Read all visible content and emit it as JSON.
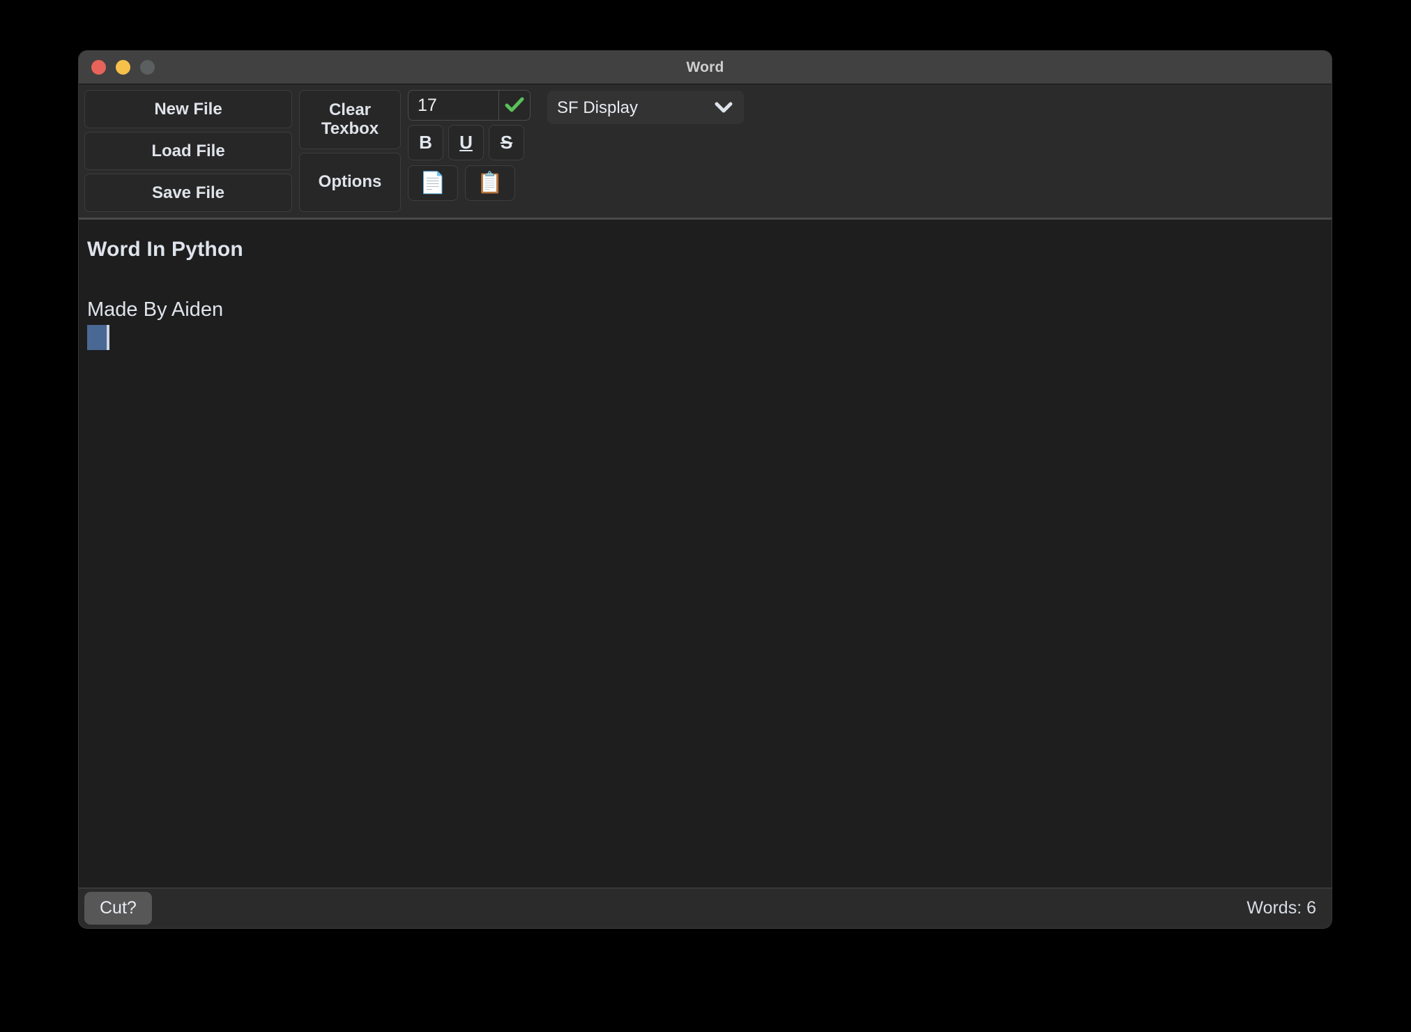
{
  "window": {
    "title": "Word",
    "traffic_lights": [
      {
        "name": "close",
        "color": "#e8635a"
      },
      {
        "name": "minimize",
        "color": "#f5c14b"
      },
      {
        "name": "zoom",
        "color": "#5c5f5f"
      }
    ]
  },
  "toolbar": {
    "file_buttons": [
      {
        "label": "New File"
      },
      {
        "label": "Load File"
      },
      {
        "label": "Save File"
      }
    ],
    "clear_textbox_label": "Clear\nTexbox",
    "clear_textbox_line1": "Clear",
    "clear_textbox_line2": "Texbox",
    "options_label": "Options",
    "font_size": {
      "value": "17",
      "placeholder": "Size",
      "confirm_icon": "checkmark-icon",
      "confirm_color": "#5bbf5b"
    },
    "style_buttons": [
      {
        "name": "bold",
        "label": "B"
      },
      {
        "name": "underline",
        "label": "U"
      },
      {
        "name": "strikethrough",
        "label": "S"
      }
    ],
    "clipboard_buttons": [
      {
        "name": "copy",
        "icon": "copy-pages-icon",
        "glyph": "📄"
      },
      {
        "name": "paste",
        "icon": "clipboard-icon",
        "glyph": "📋"
      }
    ],
    "font_family": {
      "selected": "SF Display",
      "options": [
        "SF Display"
      ],
      "chevron_icon": "chevron-down-icon"
    }
  },
  "document": {
    "heading": "Word In Python",
    "paragraph": "Made By Aiden",
    "selection_color": "#4a6894"
  },
  "statusbar": {
    "cut_label": "Cut?",
    "word_count_label": "Words: 6"
  }
}
